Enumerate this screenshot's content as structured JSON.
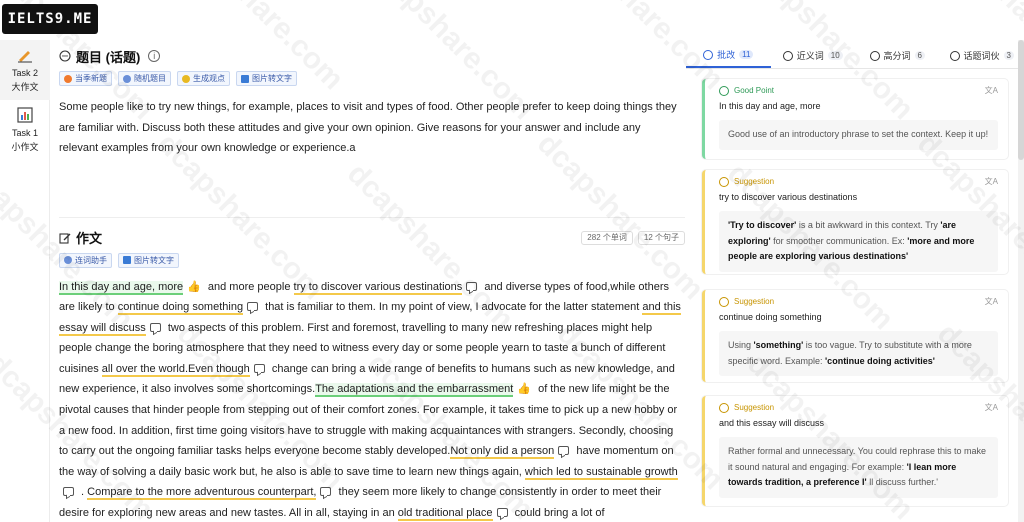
{
  "brand": {
    "logo": "IELTS9.ME"
  },
  "rail": [
    {
      "label_en": "Task 2",
      "label_cn": "大作文",
      "icon": "pen-icon",
      "active": true
    },
    {
      "label_en": "Task 1",
      "label_cn": "小作文",
      "icon": "chart-icon",
      "active": false
    }
  ],
  "topic": {
    "title": "题目 (话题)",
    "chips": [
      "当季新题",
      "随机题目",
      "生成观点",
      "图片转文字"
    ],
    "text": "Some people like to try new things, for example, places to visit and types of food. Other people prefer to keep doing things they are familiar with. Discuss both these attitudes and give your own opinion. Give reasons for your answer and include any relevant examples from your own knowledge or experience.a"
  },
  "essay": {
    "title": "作文",
    "chips": [
      "连词助手",
      "图片转文字"
    ],
    "word_count": "282 个单词",
    "sentence_count": "12 个句子",
    "segments": [
      {
        "t": "In this day and age, more",
        "k": "g"
      },
      {
        "t": " and more people ",
        "k": ""
      },
      {
        "t": "try to discover various destinations",
        "k": "y"
      },
      {
        "t": " and diverse types of food,while others are likely to ",
        "k": ""
      },
      {
        "t": "continue doing something",
        "k": "y"
      },
      {
        "t": " that is familiar to them. In my point of view, I advocate for the latter statement ",
        "k": ""
      },
      {
        "t": "and this essay will discuss",
        "k": "y"
      },
      {
        "t": " two aspects of this problem. First and foremost, travelling to many new refreshing places might help people change the boring atmosphere that they need to witness every day or some people yearn to taste a bunch of different cuisines ",
        "k": ""
      },
      {
        "t": "all over the world.Even though",
        "k": "y"
      },
      {
        "t": " change can bring a wide range of benefits to humans such as new knowledge, and new experience, it also involves some shortcomings.",
        "k": ""
      },
      {
        "t": "The adaptations and the embarrassment",
        "k": "g"
      },
      {
        "t": " of the new life might be the pivotal causes that hinder people from stepping out of their comfort zones. For example, it takes time to pick up a new hobby or a new food. In addition, first time going visitors have to struggle with making acquaintances with strangers. Secondly, choosing to carry out the ongoing familiar tasks helps everyone become stably developed.",
        "k": ""
      },
      {
        "t": "Not only did a person",
        "k": "y"
      },
      {
        "t": " have momentum on the way of solving a daily basic work but, he also is able to save time to learn new things again, ",
        "k": ""
      },
      {
        "t": "which led to sustainable growth",
        "k": "y"
      },
      {
        "t": " . ",
        "k": ""
      },
      {
        "t": "Compare to the more adventurous counterpart,",
        "k": "y"
      },
      {
        "t": " they seem more likely to change consistently in order to meet their desire for exploring new areas and new tastes. All in all, staying in an ",
        "k": ""
      },
      {
        "t": "old traditional place",
        "k": "y"
      },
      {
        "t": " could bring a lot of benefits.However, I totally",
        "k": ""
      }
    ]
  },
  "panel": {
    "tabs": [
      {
        "label": "批改",
        "count": "11",
        "icon": "edit-icon",
        "active": true
      },
      {
        "label": "近义词",
        "count": "10",
        "icon": "synonym-icon",
        "active": false
      },
      {
        "label": "高分词",
        "count": "6",
        "icon": "score-icon",
        "active": false
      },
      {
        "label": "话题词伙",
        "count": "3",
        "icon": "topic-icon",
        "active": false
      }
    ],
    "cards": [
      {
        "kind": "good",
        "type_label": "Good Point",
        "target": "In this day and age, more",
        "body_html": "Good use of an introductory phrase to set the context. Keep it up!"
      },
      {
        "kind": "sugg",
        "type_label": "Suggestion",
        "target": "try to discover various destinations",
        "body_html": "<b>'Try to discover'</b> is a bit awkward in this context. Try <b>'are exploring'</b> for smoother communication. Ex: <b>'more and more people are exploring various destinations'</b>"
      },
      {
        "kind": "sugg",
        "type_label": "Suggestion",
        "target": "continue doing something",
        "body_html": "Using <b>'something'</b> is too vague. Try to substitute with a more specific word. Example: <b>'continue doing activities'</b>"
      },
      {
        "kind": "sugg",
        "type_label": "Suggestion",
        "target": "and this essay will discuss",
        "body_html": "Rather formal and unnecessary. You could rephrase this to make it sound natural and engaging. For example: <b>'I lean more towards tradition, a preference I'</b> ll discuss further.'"
      }
    ],
    "translate_label": "文A"
  },
  "watermark": "dcapshare.com",
  "colors": {
    "accent": "#2f62d6",
    "good": "#7ed8a2",
    "suggestion": "#f5d66b"
  }
}
